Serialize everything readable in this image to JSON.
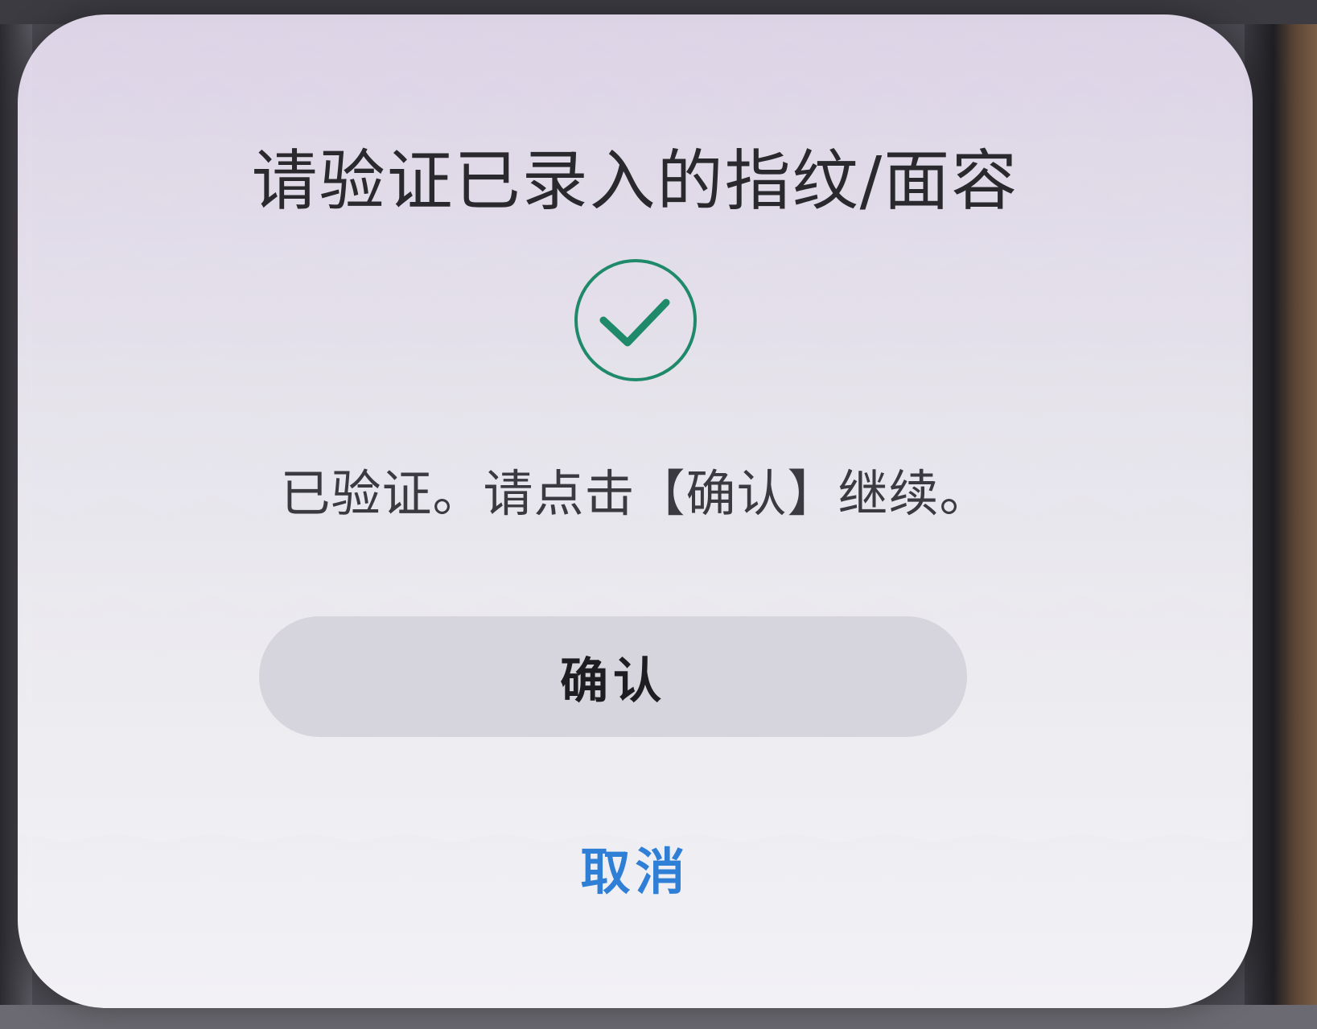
{
  "dialog": {
    "title": "请验证已录入的指纹/面容",
    "status_icon": "check-circle-icon",
    "status_color": "#1f8a6a",
    "message": "已验证。请点击【确认】继续。",
    "confirm_label": "确认",
    "cancel_label": "取消",
    "cancel_color": "#2f7fd6"
  }
}
